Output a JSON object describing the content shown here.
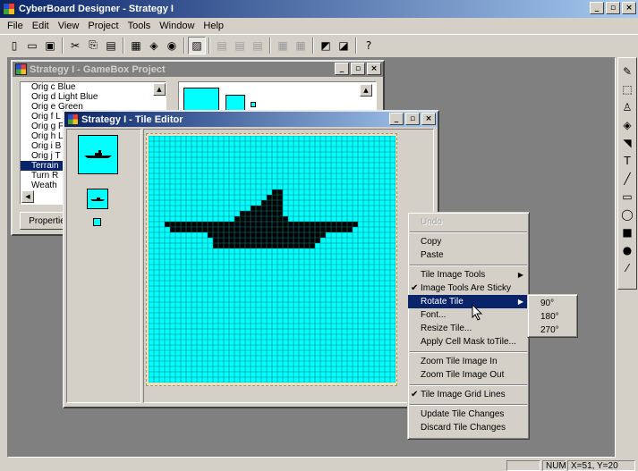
{
  "app": {
    "title": "CyberBoard Designer - Strategy I"
  },
  "caption_buttons": {
    "minimize": "_",
    "restore": "▫",
    "close": "×"
  },
  "menu": [
    "File",
    "Edit",
    "View",
    "Project",
    "Tools",
    "Window",
    "Help"
  ],
  "toolbar": {
    "buttons": [
      {
        "name": "new-icon",
        "glyph": "▯",
        "disabled": false
      },
      {
        "name": "open-icon",
        "glyph": "▭",
        "disabled": false
      },
      {
        "name": "save-icon",
        "glyph": "▣",
        "disabled": false
      },
      {
        "name": "cut-icon",
        "glyph": "✂",
        "disabled": false
      },
      {
        "name": "copy-icon",
        "glyph": "⎘",
        "disabled": false
      },
      {
        "name": "paste-icon",
        "glyph": "▤",
        "disabled": false
      },
      {
        "name": "board-icon",
        "glyph": "▦",
        "disabled": false
      },
      {
        "name": "tray-icon",
        "glyph": "◈",
        "disabled": false
      },
      {
        "name": "pieces-icon",
        "glyph": "◉",
        "disabled": false
      },
      {
        "name": "grid-icon",
        "glyph": "▨",
        "disabled": false,
        "pressed": true
      },
      {
        "name": "layer1-icon",
        "glyph": "▤",
        "disabled": true
      },
      {
        "name": "layer2-icon",
        "glyph": "▤",
        "disabled": true
      },
      {
        "name": "layer3-icon",
        "glyph": "▤",
        "disabled": true
      },
      {
        "name": "table1-icon",
        "glyph": "▦",
        "disabled": true
      },
      {
        "name": "table2-icon",
        "glyph": "▦",
        "disabled": true
      },
      {
        "name": "front-icon",
        "glyph": "◩",
        "disabled": false
      },
      {
        "name": "back-icon",
        "glyph": "◪",
        "disabled": false
      },
      {
        "name": "context-help-icon",
        "glyph": "?",
        "disabled": false
      }
    ]
  },
  "tool_palette": [
    {
      "name": "pencil-tool-icon",
      "glyph": "✎"
    },
    {
      "name": "select-tool-icon",
      "glyph": "⬚"
    },
    {
      "name": "bucket-tool-icon",
      "glyph": "♙"
    },
    {
      "name": "fill-tool-icon",
      "glyph": "◈"
    },
    {
      "name": "color-swap-icon",
      "glyph": "◥"
    },
    {
      "name": "text-tool-icon",
      "glyph": "T"
    },
    {
      "name": "line-tool-icon",
      "glyph": "╱"
    },
    {
      "name": "rectangle-tool-icon",
      "glyph": "▭"
    },
    {
      "name": "ellipse-tool-icon",
      "glyph": "◯"
    },
    {
      "name": "filled-rectangle-icon",
      "glyph": "■"
    },
    {
      "name": "filled-ellipse-icon",
      "glyph": "●"
    },
    {
      "name": "dropper-tool-icon",
      "glyph": "⁄"
    }
  ],
  "gamebox_window": {
    "title": "Strategy I - GameBox Project",
    "list": [
      "Orig c Blue",
      "Orig d Light Blue",
      "Orig e Green",
      "Orig f L",
      "Orig g F",
      "Orig h L",
      "Orig i B",
      "Orig j T",
      "Terrain",
      "Turn R",
      "Weath"
    ],
    "selected_index": 8,
    "properties_button": "Properties"
  },
  "tile_editor": {
    "title": "Strategy I - Tile Editor",
    "tile_color": "#00ffff",
    "grid_line_color": "#008080",
    "pixel_color": "#000000"
  },
  "context_menu": {
    "items": [
      {
        "type": "item",
        "label": "Undo",
        "disabled": true
      },
      {
        "type": "sep"
      },
      {
        "type": "item",
        "label": "Copy"
      },
      {
        "type": "item",
        "label": "Paste"
      },
      {
        "type": "sep"
      },
      {
        "type": "item",
        "label": "Tile Image Tools",
        "submenu": true
      },
      {
        "type": "item",
        "label": "Image Tools Are Sticky",
        "checked": true
      },
      {
        "type": "item",
        "label": "Rotate Tile",
        "submenu": true,
        "highlighted": true
      },
      {
        "type": "item",
        "label": "Font..."
      },
      {
        "type": "item",
        "label": "Resize Tile..."
      },
      {
        "type": "item",
        "label": "Apply Cell Mask toTile..."
      },
      {
        "type": "sep"
      },
      {
        "type": "item",
        "label": "Zoom Tile Image In"
      },
      {
        "type": "item",
        "label": "Zoom Tile Image Out"
      },
      {
        "type": "sep"
      },
      {
        "type": "item",
        "label": "Tile Image Grid Lines",
        "checked": true
      },
      {
        "type": "sep"
      },
      {
        "type": "item",
        "label": "Update Tile Changes"
      },
      {
        "type": "item",
        "label": "Discard Tile Changes"
      }
    ],
    "rotate_submenu": [
      "90°",
      "180°",
      "270°"
    ]
  },
  "status_bar": {
    "num": "NUM",
    "coords": "X=51, Y=20"
  }
}
